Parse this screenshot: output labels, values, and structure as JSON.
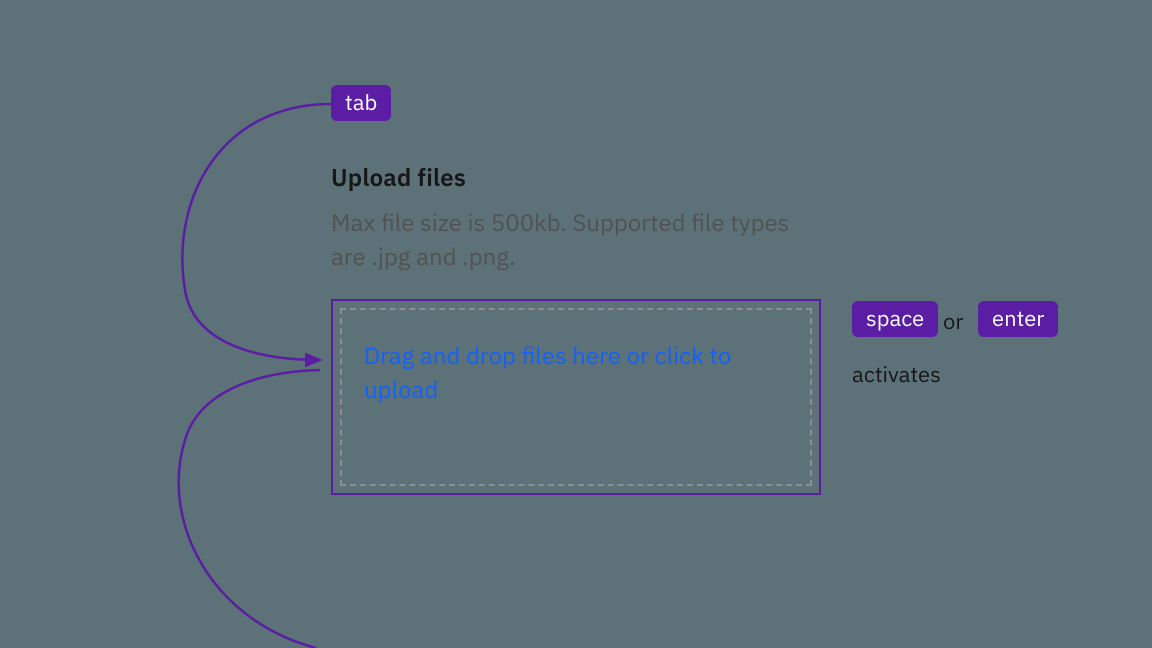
{
  "keys": {
    "tab": "tab",
    "space": "space",
    "enter": "enter",
    "or": "or",
    "activates": "activates"
  },
  "uploader": {
    "heading": "Upload files",
    "subtext": "Max file size is 500kb. Supported file types are .jpg and .png.",
    "dropzone_text": "Drag and drop files here or click to upload"
  },
  "colors": {
    "background": "#5d7278",
    "accent": "#5a1da3",
    "text_primary": "#161616",
    "text_secondary": "#525252",
    "link": "#0f62fe",
    "dashed_border": "#8d8d8d"
  }
}
